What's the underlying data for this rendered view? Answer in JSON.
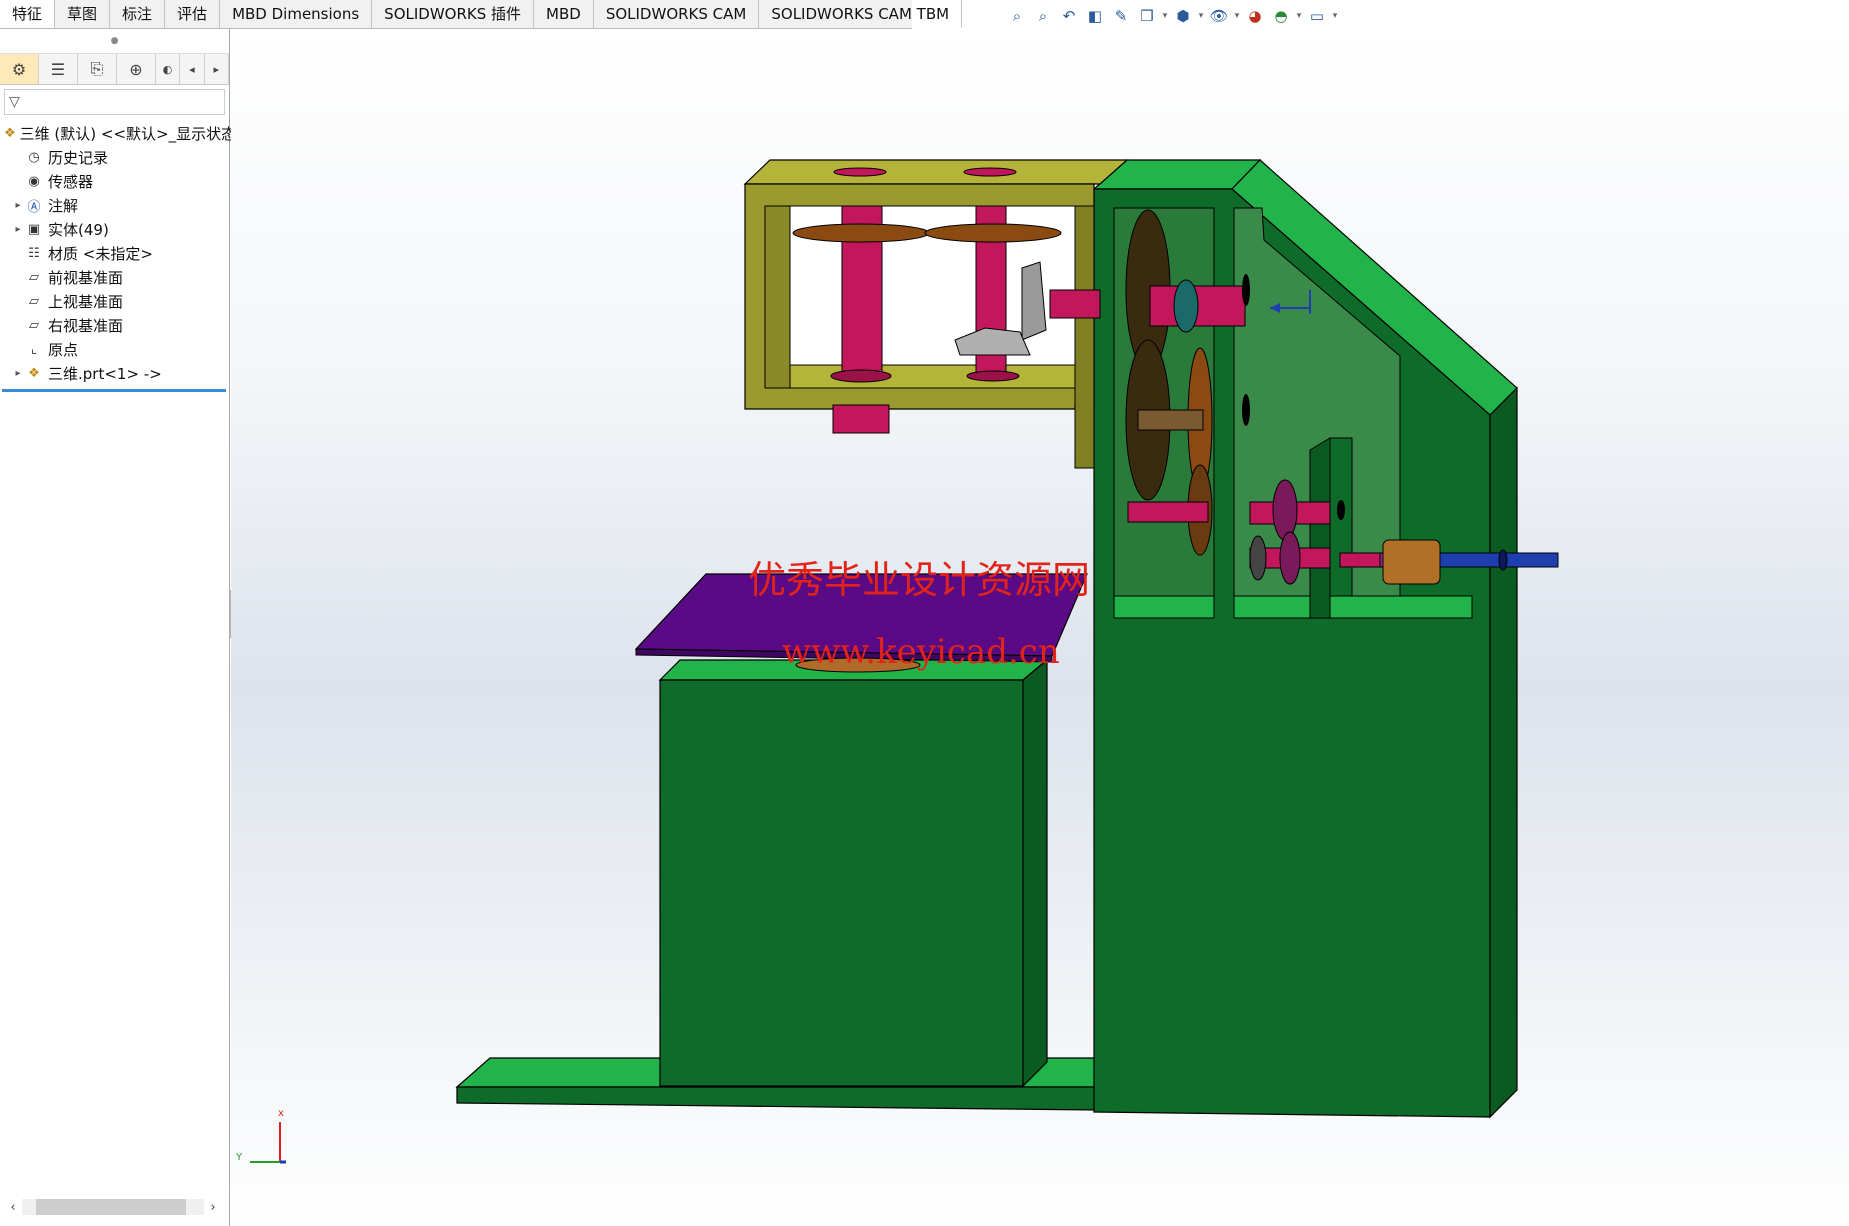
{
  "tabs": [
    {
      "label": "特征",
      "active": true
    },
    {
      "label": "草图",
      "active": false
    },
    {
      "label": "标注",
      "active": false
    },
    {
      "label": "评估",
      "active": false
    },
    {
      "label": "MBD Dimensions",
      "active": false
    },
    {
      "label": "SOLIDWORKS 插件",
      "active": false
    },
    {
      "label": "MBD",
      "active": false
    },
    {
      "label": "SOLIDWORKS CAM",
      "active": false
    },
    {
      "label": "SOLIDWORKS CAM TBM",
      "active": false
    }
  ],
  "hud_icons": [
    "zoom-to-fit-icon",
    "zoom-area-icon",
    "previous-view-icon",
    "section-view-icon",
    "dynamic-annotation-icon",
    "view-orientation-icon",
    "display-style-icon",
    "hide-show-icon",
    "edit-appearance-icon",
    "scene-icon",
    "view-setting-icon"
  ],
  "panel_tabs": [
    "feature-manager-icon",
    "property-manager-icon",
    "configuration-manager-icon",
    "dimxpert-icon",
    "display-manager-icon"
  ],
  "tree": {
    "root": "三维 (默认) <<默认>_显示状态",
    "items": [
      {
        "label": "历史记录",
        "icon": "history-icon",
        "expandable": false
      },
      {
        "label": "传感器",
        "icon": "sensor-icon",
        "expandable": false
      },
      {
        "label": "注解",
        "icon": "annotation-icon",
        "expandable": true
      },
      {
        "label": "实体(49)",
        "icon": "solid-bodies-icon",
        "expandable": true
      },
      {
        "label": "材质 <未指定>",
        "icon": "material-icon",
        "expandable": false
      },
      {
        "label": "前视基准面",
        "icon": "plane-icon",
        "expandable": false
      },
      {
        "label": "上视基准面",
        "icon": "plane-icon",
        "expandable": false
      },
      {
        "label": "右视基准面",
        "icon": "plane-icon",
        "expandable": false
      },
      {
        "label": "原点",
        "icon": "origin-icon",
        "expandable": false
      },
      {
        "label": "三维.prt<1> ->",
        "icon": "part-icon",
        "expandable": true
      }
    ]
  },
  "watermark": {
    "line1": "优秀毕业设计资源网",
    "line2": "www.keyicad.cn"
  },
  "triad": {
    "x_label": "X",
    "y_label": "Y"
  },
  "colors": {
    "frame_green": "#0e6b2a",
    "frame_green_light": "#22b34a",
    "top_bracket": "#9a9a2e",
    "table_purple": "#5a0a84",
    "shaft_magenta": "#c2185b",
    "gear_bronze": "#8a4a12",
    "accent_blue": "#1f3fb0"
  }
}
